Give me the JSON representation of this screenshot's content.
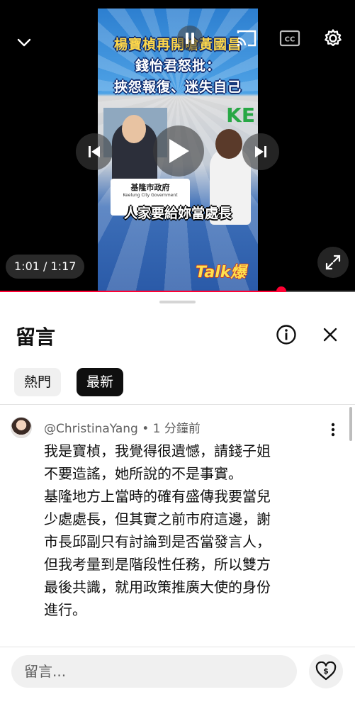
{
  "video": {
    "headline_line1": "楊寶楨再開嗆黃國昌",
    "headline_line2": "錢怡君怒批：",
    "headline_line3": "挾怨報復、迷失自己",
    "podium_name": "基隆市政府",
    "podium_sub": "Keelung City Government",
    "subtitle": "人家要給妳當處長",
    "logo_text": "KE",
    "show_logo": "Talk爆",
    "time_display": "1:01 / 1:17",
    "progress_fraction": 0.7917
  },
  "comments_panel": {
    "title": "留言",
    "chips": {
      "top": "熱門",
      "newest": "最新"
    },
    "comment": {
      "author": "@ChristinaYang",
      "time": "1 分鐘前",
      "meta": "@ChristinaYang • 1 分鐘前",
      "lines": [
        "我是寶楨，我覺得很遺憾，請錢子姐",
        "不要造謠，她所說的不是事實。",
        "基隆地方上當時的確有盛傳我要當兒",
        "少處處長，但其實之前市府這邊，謝",
        "市長邱副只有討論到是否當發言人，",
        "但我考量到是階段性任務，所以雙方",
        "最後共識，就用政策推廣大使的身份",
        "進行。"
      ]
    },
    "reply_placeholder": "留言...",
    "colors": {
      "progress": "#ff0033",
      "active_chip": "#0f0f0f"
    }
  }
}
